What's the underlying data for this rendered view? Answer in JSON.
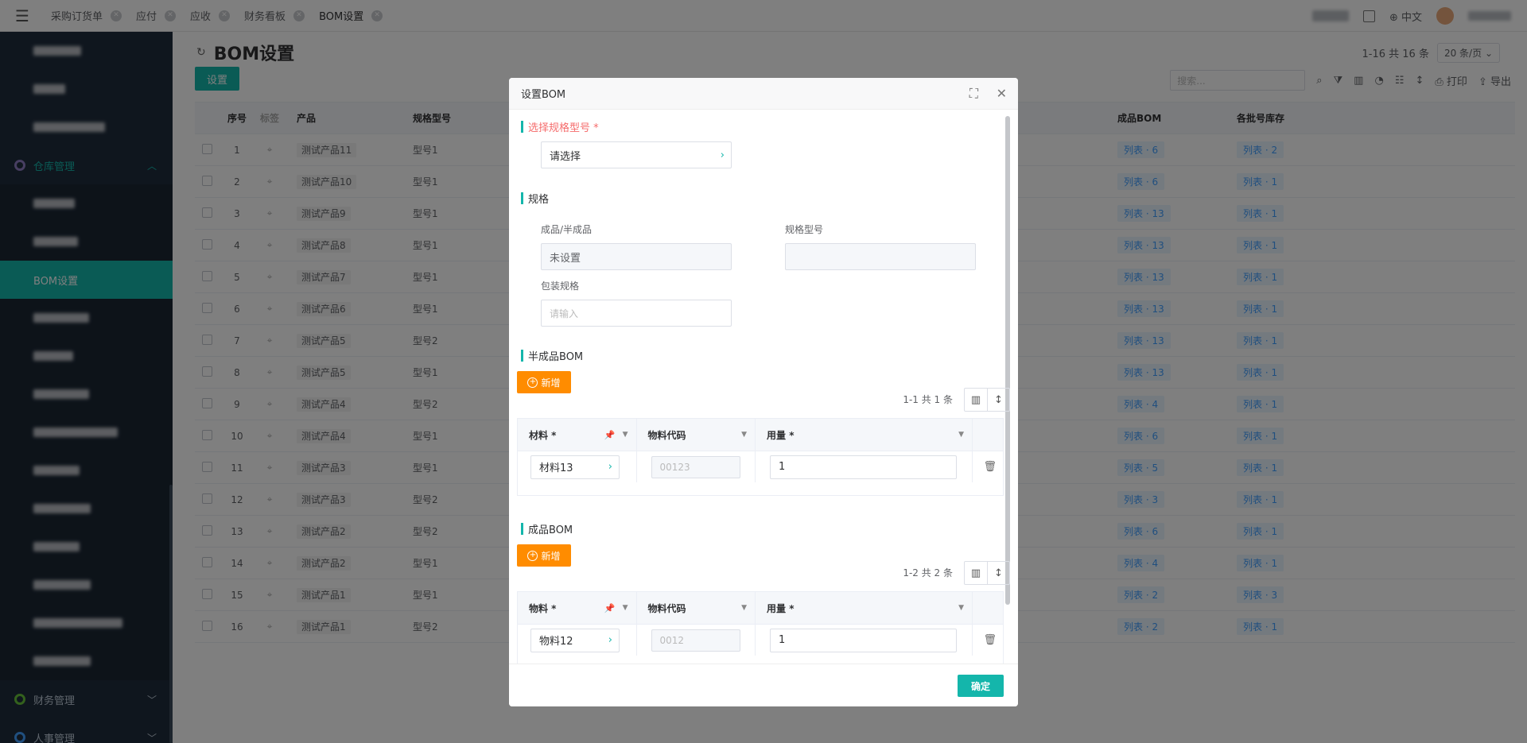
{
  "tabs": [
    "采购订货单",
    "应付",
    "应收",
    "财务看板",
    "BOM设置"
  ],
  "top_right": {
    "lang": "中文"
  },
  "sidebar": {
    "warehouse_group": "仓库管理",
    "active_item": "BOM设置",
    "finance_group": "财务管理",
    "hr_group": "人事管理"
  },
  "page": {
    "title": "BOM设置",
    "pager": "1-16 共 16 条",
    "page_size": "20 条/页",
    "set_button": "设置",
    "search_placeholder": "搜索...",
    "print_label": "打印",
    "export_label": "导出"
  },
  "grid": {
    "headers": {
      "no": "序号",
      "tag": "标签",
      "product": "产品",
      "spec": "规格型号",
      "semi_bom": "成品BOM",
      "stock": "各批号库存"
    },
    "rows": [
      {
        "no": "1",
        "product": "测试产品11",
        "spec": "型号1",
        "semi": "列表 · 6",
        "stock": "列表 · 2"
      },
      {
        "no": "2",
        "product": "测试产品10",
        "spec": "型号1",
        "semi": "列表 · 6",
        "stock": "列表 · 1"
      },
      {
        "no": "3",
        "product": "测试产品9",
        "spec": "型号1",
        "semi": "列表 · 13",
        "stock": "列表 · 1"
      },
      {
        "no": "4",
        "product": "测试产品8",
        "spec": "型号1",
        "semi": "列表 · 13",
        "stock": "列表 · 1"
      },
      {
        "no": "5",
        "product": "测试产品7",
        "spec": "型号1",
        "semi": "列表 · 13",
        "stock": "列表 · 1"
      },
      {
        "no": "6",
        "product": "测试产品6",
        "spec": "型号1",
        "semi": "列表 · 13",
        "stock": "列表 · 1"
      },
      {
        "no": "7",
        "product": "测试产品5",
        "spec": "型号2",
        "semi": "列表 · 13",
        "stock": "列表 · 1"
      },
      {
        "no": "8",
        "product": "测试产品5",
        "spec": "型号1",
        "semi": "列表 · 13",
        "stock": "列表 · 1"
      },
      {
        "no": "9",
        "product": "测试产品4",
        "spec": "型号2",
        "semi": "列表 · 4",
        "stock": "列表 · 1"
      },
      {
        "no": "10",
        "product": "测试产品4",
        "spec": "型号1",
        "semi": "列表 · 6",
        "stock": "列表 · 1"
      },
      {
        "no": "11",
        "product": "测试产品3",
        "spec": "型号1",
        "semi": "列表 · 5",
        "stock": "列表 · 1"
      },
      {
        "no": "12",
        "product": "测试产品3",
        "spec": "型号2",
        "semi": "列表 · 3",
        "stock": "列表 · 1"
      },
      {
        "no": "13",
        "product": "测试产品2",
        "spec": "型号2",
        "semi": "列表 · 6",
        "stock": "列表 · 1"
      },
      {
        "no": "14",
        "product": "测试产品2",
        "spec": "型号1",
        "semi": "列表 · 4",
        "stock": "列表 · 1"
      },
      {
        "no": "15",
        "product": "测试产品1",
        "spec": "型号1",
        "semi": "列表 · 2",
        "stock": "列表 · 3"
      },
      {
        "no": "16",
        "product": "测试产品1",
        "spec": "型号2",
        "semi": "列表 · 2",
        "stock": "列表 · 1"
      }
    ]
  },
  "dialog": {
    "title": "设置BOM",
    "select_spec_label": "选择规格型号 *",
    "select_placeholder": "请选择",
    "spec_section": "规格",
    "product_type_label": "成品/半成品",
    "product_type_value": "未设置",
    "spec_model_label": "规格型号",
    "packaging_label": "包装规格",
    "packaging_placeholder": "请输入",
    "semi_bom_section": "半成品BOM",
    "add_label": "新增",
    "semi_pager": "1-1 共 1 条",
    "semi_headers": {
      "material": "材料 *",
      "code": "物料代码",
      "qty": "用量 *"
    },
    "semi_rows": [
      {
        "material": "材料13",
        "code": "00123",
        "qty": "1"
      }
    ],
    "finished_bom_section": "成品BOM",
    "finished_pager": "1-2 共 2 条",
    "finished_headers": {
      "material": "物料 *",
      "code": "物料代码",
      "qty": "用量 *"
    },
    "finished_rows": [
      {
        "material": "物料12",
        "code": "0012",
        "qty": "1"
      }
    ],
    "ok_label": "确定"
  }
}
